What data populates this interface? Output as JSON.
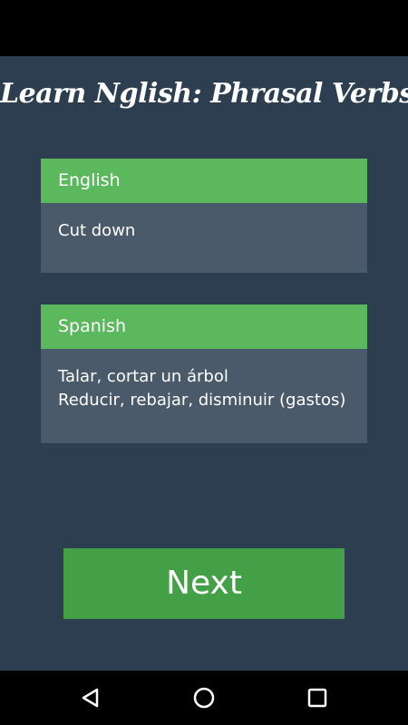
{
  "app": {
    "title": "Learn Nglish: Phrasal Verbs"
  },
  "english_card": {
    "header": "English",
    "lines": [
      "Cut down"
    ]
  },
  "spanish_card": {
    "header": "Spanish",
    "lines": [
      "Talar, cortar un árbol",
      "Reducir, rebajar, disminuir (gastos)"
    ]
  },
  "next_button": {
    "label": "Next"
  },
  "nav_bar": {
    "icons": [
      "back-icon",
      "home-icon",
      "recents-icon"
    ]
  },
  "colors": {
    "background": "#2c3e50",
    "card_header": "#5cb85c",
    "card_body": "#4b5a6b",
    "button": "#43a047"
  }
}
